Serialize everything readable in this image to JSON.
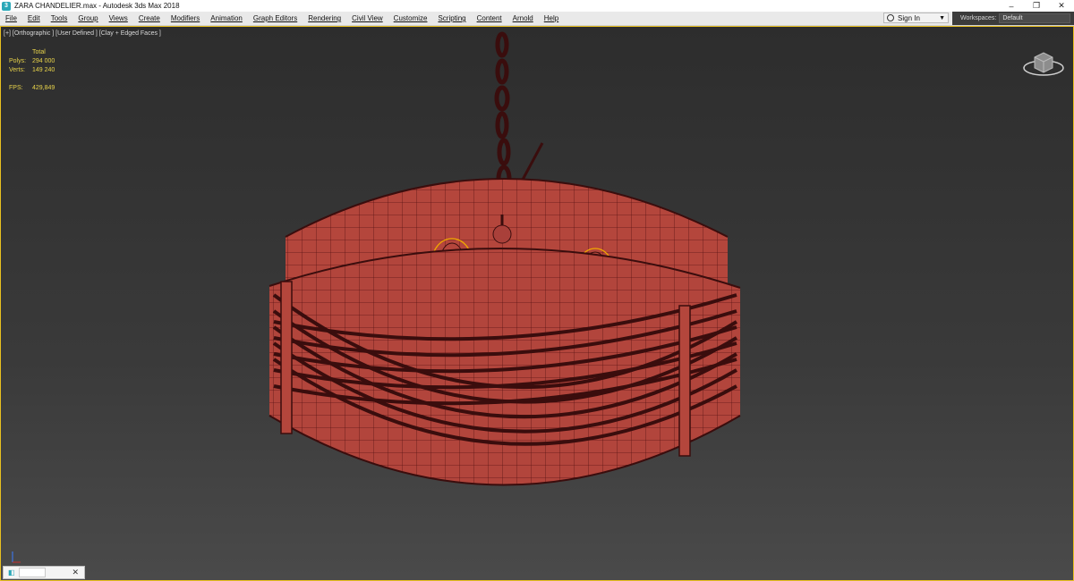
{
  "window": {
    "title": "ZARA CHANDELIER.max - Autodesk 3ds Max 2018",
    "controls": [
      "–",
      "❐",
      "✕"
    ]
  },
  "menu": [
    "File",
    "Edit",
    "Tools",
    "Group",
    "Views",
    "Create",
    "Modifiers",
    "Animation",
    "Graph Editors",
    "Rendering",
    "Civil View",
    "Customize",
    "Scripting",
    "Content",
    "Arnold",
    "Help"
  ],
  "signin": {
    "label": "Sign In"
  },
  "workspaces": {
    "label": "Workspaces:",
    "value": "Default"
  },
  "viewport": {
    "label": "[+] [Orthographic ] [User Defined ] [Clay + Edged Faces ]",
    "stats": {
      "header": "Total",
      "polys_label": "Polys:",
      "polys": "294 000",
      "verts_label": "Verts:",
      "verts": "149 240",
      "fps_label": "FPS:",
      "fps": "429,849"
    }
  },
  "colors": {
    "model": "#b2453c",
    "wire": "#5a1414",
    "selection": "#f0a800",
    "viewport_border": "#e8c020"
  },
  "icons": {
    "viewcube": "viewcube-icon",
    "user": "user-icon",
    "axis": "axis-gizmo-icon",
    "app": "3dsmax-logo-icon"
  }
}
